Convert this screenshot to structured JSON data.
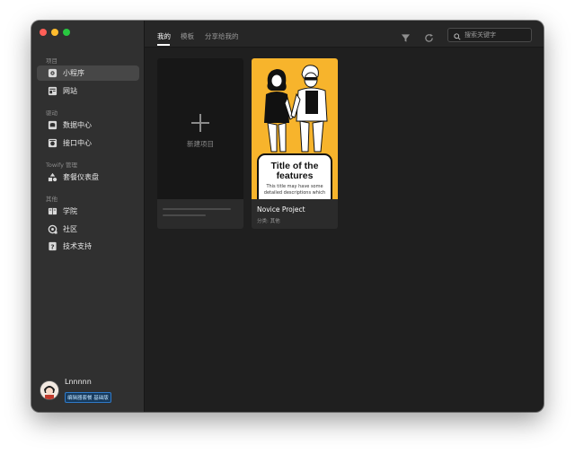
{
  "sidebar": {
    "sections": [
      {
        "label": "项目"
      },
      {
        "label": "驱动"
      },
      {
        "label": "Towify 管理"
      },
      {
        "label": "其他"
      }
    ],
    "items": [
      {
        "label": "小程序",
        "icon": "mini-program-icon"
      },
      {
        "label": "网站",
        "icon": "website-icon"
      },
      {
        "label": "数据中心",
        "icon": "data-center-icon"
      },
      {
        "label": "接口中心",
        "icon": "api-center-icon"
      },
      {
        "label": "套餐仪表盘",
        "icon": "dashboard-icon"
      },
      {
        "label": "学院",
        "icon": "academy-icon"
      },
      {
        "label": "社区",
        "icon": "community-icon"
      },
      {
        "label": "技术支持",
        "icon": "support-icon"
      }
    ],
    "active_item": "小程序",
    "user": {
      "name": "Lnnnnn",
      "badge": "编辑器套餐 基础版"
    }
  },
  "topbar": {
    "tabs": [
      {
        "label": "我的"
      },
      {
        "label": "模板"
      },
      {
        "label": "分享给我的"
      }
    ],
    "active_tab": "我的",
    "search_placeholder": "搜索关键字"
  },
  "main": {
    "new_project_label": "新建项目",
    "project": {
      "name": "Novice Project",
      "category": "分类: 其他",
      "thumb_title": "Title of the features",
      "thumb_desc": "This title may have some detailed descriptions which",
      "thumb_bg": "#f7b42c"
    }
  },
  "colors": {
    "window_bg": "#1f1f1f",
    "sidebar_bg": "#303030",
    "active_item_bg": "#474747",
    "badge_border": "#2f7ac9"
  }
}
